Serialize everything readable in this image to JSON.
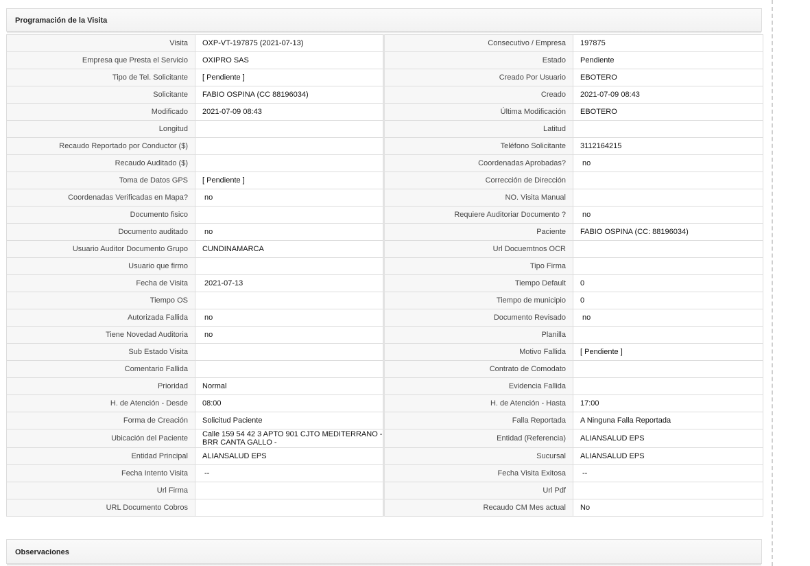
{
  "programacion": {
    "title": "Programación de la Visita",
    "rows": [
      [
        {
          "label": "Visita",
          "value": "OXP-VT-197875 (2021-07-13)"
        },
        {
          "label": "Consecutivo / Empresa",
          "value": "197875"
        }
      ],
      [
        {
          "label": "Empresa que Presta el Servicio",
          "value": "OXIPRO SAS"
        },
        {
          "label": "Estado",
          "value": "Pendiente"
        }
      ],
      [
        {
          "label": "Tipo de Tel. Solicitante",
          "value": "[ Pendiente ]"
        },
        {
          "label": "Creado Por Usuario",
          "value": "EBOTERO"
        }
      ],
      [
        {
          "label": "Solicitante",
          "value": "FABIO OSPINA (CC 88196034)"
        },
        {
          "label": "Creado",
          "value": "2021-07-09 08:43"
        }
      ],
      [
        {
          "label": "Modificado",
          "value": "2021-07-09 08:43"
        },
        {
          "label": "Última Modificación",
          "value": "EBOTERO"
        }
      ],
      [
        {
          "label": "Longitud",
          "value": ""
        },
        {
          "label": "Latitud",
          "value": ""
        }
      ],
      [
        {
          "label": "Recaudo Reportado por Conductor ($)",
          "value": ""
        },
        {
          "label": "Teléfono Solicitante",
          "value": "3112164215"
        }
      ],
      [
        {
          "label": "Recaudo Auditado ($)",
          "value": ""
        },
        {
          "label": "Coordenadas Aprobadas?",
          "value": "no"
        }
      ],
      [
        {
          "label": "Toma de Datos GPS",
          "value": "[ Pendiente ]"
        },
        {
          "label": "Corrección de Dirección",
          "value": ""
        }
      ],
      [
        {
          "label": "Coordenadas Verificadas en Mapa?",
          "value": "no"
        },
        {
          "label": "NO. Visita Manual",
          "value": ""
        }
      ],
      [
        {
          "label": "Documento fisico",
          "value": ""
        },
        {
          "label": "Requiere Auditoriar Documento ?",
          "value": "no"
        }
      ],
      [
        {
          "label": "Documento auditado",
          "value": "no"
        },
        {
          "label": "Paciente",
          "value": "FABIO OSPINA (CC: 88196034)"
        }
      ],
      [
        {
          "label": "Usuario Auditor Documento Grupo",
          "value": "CUNDINAMARCA"
        },
        {
          "label": "Url Docuemtnos OCR",
          "value": ""
        }
      ],
      [
        {
          "label": "Usuario que firmo",
          "value": ""
        },
        {
          "label": "Tipo Firma",
          "value": ""
        }
      ],
      [
        {
          "label": "Fecha de Visita",
          "value": "2021-07-13"
        },
        {
          "label": "Tiempo Default",
          "value": "0"
        }
      ],
      [
        {
          "label": "Tiempo OS",
          "value": ""
        },
        {
          "label": "Tiempo de municipio",
          "value": "0"
        }
      ],
      [
        {
          "label": "Autorizada Fallida",
          "value": "no"
        },
        {
          "label": "Documento Revisado",
          "value": "no"
        }
      ],
      [
        {
          "label": "Tiene Novedad Auditoria",
          "value": "no"
        },
        {
          "label": "Planilla",
          "value": ""
        }
      ],
      [
        {
          "label": "Sub Estado Visita",
          "value": ""
        },
        {
          "label": "Motivo Fallida",
          "value": "[ Pendiente ]"
        }
      ],
      [
        {
          "label": "Comentario Fallida",
          "value": ""
        },
        {
          "label": "Contrato de Comodato",
          "value": ""
        }
      ],
      [
        {
          "label": "Prioridad",
          "value": "Normal"
        },
        {
          "label": "Evidencia Fallida",
          "value": ""
        }
      ],
      [
        {
          "label": "H. de Atención - Desde",
          "value": "08:00"
        },
        {
          "label": "H. de Atención - Hasta",
          "value": "17:00"
        }
      ],
      [
        {
          "label": "Forma de Creación",
          "value": "Solicitud Paciente"
        },
        {
          "label": "Falla Reportada",
          "value": "A Ninguna Falla Reportada"
        }
      ],
      [
        {
          "label": "Ubicación del Paciente",
          "value": "Calle 159 54 42 3 APTO 901 CJTO MEDITERRANO - BRR CANTA GALLO -"
        },
        {
          "label": "Entidad (Referencia)",
          "value": "ALIANSALUD EPS"
        }
      ],
      [
        {
          "label": "Entidad Principal",
          "value": "ALIANSALUD EPS"
        },
        {
          "label": "Sucursal",
          "value": "ALIANSALUD EPS"
        }
      ],
      [
        {
          "label": "Fecha Intento Visita",
          "value": "--"
        },
        {
          "label": "Fecha Visita Exitosa",
          "value": "--"
        }
      ],
      [
        {
          "label": "Url Firma",
          "value": ""
        },
        {
          "label": "Url Pdf",
          "value": ""
        }
      ],
      [
        {
          "label": "URL Documento Cobros",
          "value": ""
        },
        {
          "label": "Recaudo CM Mes actual",
          "value": "No"
        }
      ]
    ]
  },
  "observaciones": {
    "title": "Observaciones"
  }
}
